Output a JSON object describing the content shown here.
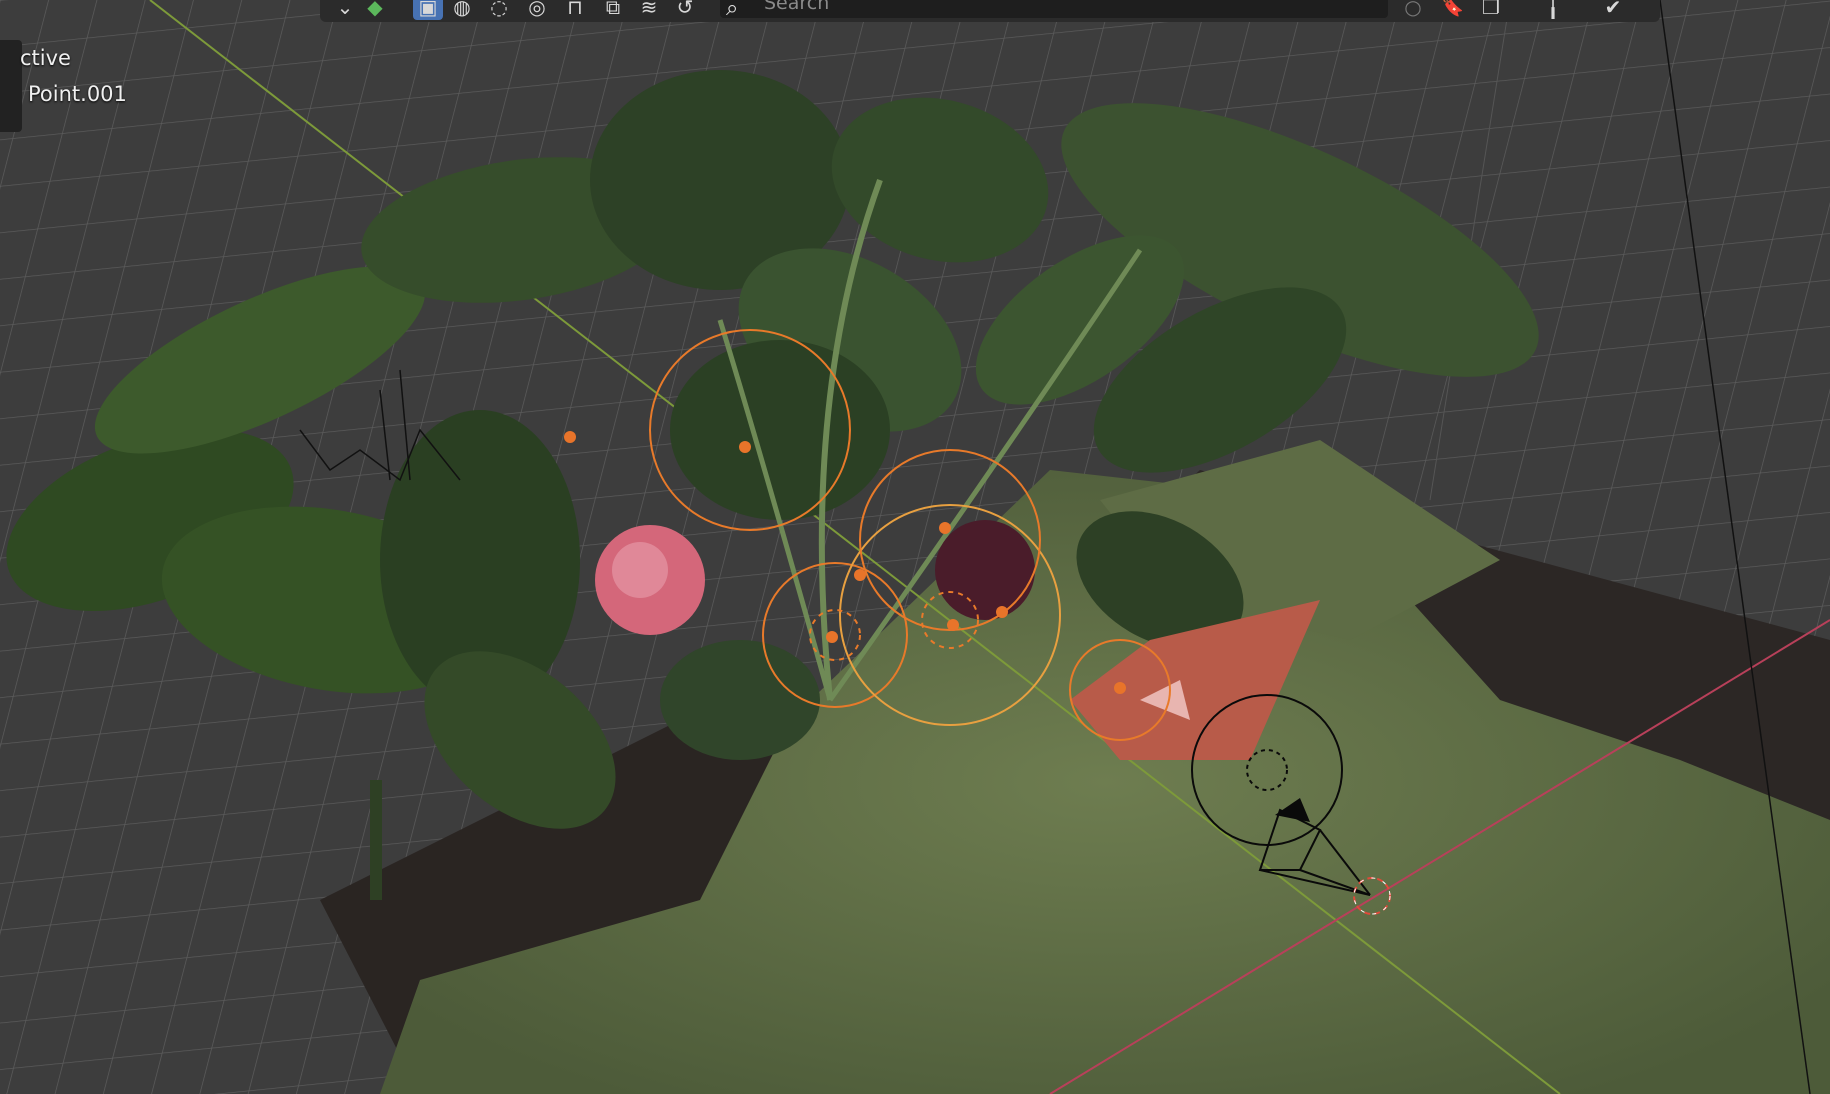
{
  "app": "Blender",
  "viewport": {
    "overlay_text": {
      "mode": "ctive",
      "object": "Point.001"
    }
  },
  "header": {
    "search": {
      "placeholder": "Search"
    },
    "buttons": [
      {
        "name": "dropdown-chevron-icon",
        "glyph": "⌄"
      },
      {
        "name": "color-cube-icon",
        "glyph": "◆"
      },
      {
        "name": "solid-shading-button",
        "glyph": "▣",
        "active": true
      },
      {
        "name": "material-preview-button",
        "glyph": "◍"
      },
      {
        "name": "render-preview-button",
        "glyph": "◌"
      },
      {
        "name": "world-shading-button",
        "glyph": "◎"
      },
      {
        "name": "overlays-button",
        "glyph": "⊓"
      },
      {
        "name": "xray-button",
        "glyph": "⧉"
      },
      {
        "name": "curves-button",
        "glyph": "≋"
      },
      {
        "name": "loop-button",
        "glyph": "↺"
      }
    ],
    "right_buttons": [
      {
        "name": "circle-toggle-icon",
        "glyph": "○"
      },
      {
        "name": "bookmark-icon",
        "glyph": "🔖"
      },
      {
        "name": "copy-dropdown-icon",
        "glyph": "❐"
      },
      {
        "name": "pin-dropdown-icon",
        "glyph": "╽"
      },
      {
        "name": "check-shield-icon",
        "glyph": "✔"
      }
    ]
  },
  "colors": {
    "viewport_bg": "#404040",
    "grid": "#5a5a5a",
    "x_axis": "#b8405a",
    "y_axis": "#7d9a3a",
    "selected_light": "#e87a2a",
    "active_blue": "#4772b3"
  }
}
